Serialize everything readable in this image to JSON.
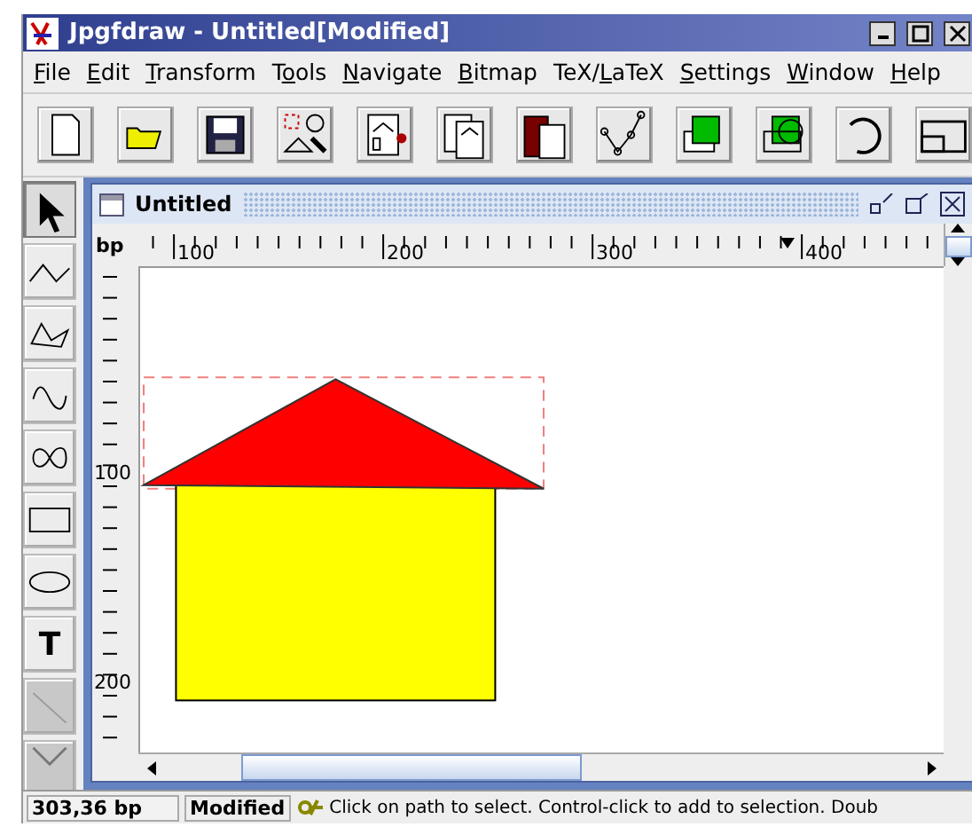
{
  "window": {
    "title": "Jpgfdraw - Untitled[Modified]"
  },
  "menu": [
    {
      "underlined": "F",
      "after": "ile"
    },
    {
      "underlined": "E",
      "after": "dit"
    },
    {
      "underlined": "T",
      "after": "ransform"
    },
    {
      "before": "T",
      "underlined": "o",
      "after": "ols"
    },
    {
      "underlined": "N",
      "after": "avigate"
    },
    {
      "underlined": "B",
      "after": "itmap"
    },
    {
      "before": "TeX/",
      "underlined": "L",
      "after": "aTeX"
    },
    {
      "underlined": "S",
      "after": "ettings"
    },
    {
      "underlined": "W",
      "after": "indow"
    },
    {
      "underlined": "H",
      "after": "elp"
    }
  ],
  "toolbar": [
    {
      "kind": "new"
    },
    {
      "kind": "open"
    },
    {
      "kind": "save"
    },
    {
      "kind": "select-all"
    },
    {
      "kind": "cut"
    },
    {
      "kind": "copy"
    },
    {
      "kind": "paste"
    },
    {
      "kind": "edit-path"
    },
    {
      "kind": "front"
    },
    {
      "kind": "back"
    },
    {
      "kind": "rotate"
    },
    {
      "kind": "reduce"
    }
  ],
  "tools": [
    {
      "kind": "select",
      "selected": true,
      "disabled": false
    },
    {
      "kind": "polyline",
      "selected": false,
      "disabled": false
    },
    {
      "kind": "closed",
      "selected": false,
      "disabled": false
    },
    {
      "kind": "curve",
      "selected": false,
      "disabled": false
    },
    {
      "kind": "loop",
      "selected": false,
      "disabled": false
    },
    {
      "kind": "rectangle",
      "selected": false,
      "disabled": false
    },
    {
      "kind": "ellipse",
      "selected": false,
      "disabled": false
    },
    {
      "kind": "text",
      "label": "T",
      "selected": false,
      "disabled": false
    },
    {
      "kind": "line",
      "selected": false,
      "disabled": true
    },
    {
      "kind": "chevron",
      "selected": false,
      "disabled": true
    }
  ],
  "document": {
    "title": "Untitled",
    "unit": "bp",
    "top_ruler": [
      "100",
      "200",
      "300",
      "400"
    ],
    "left_ruler": [
      "100",
      "200"
    ]
  },
  "status_bar": {
    "position": "303,36 bp",
    "state": "Modified",
    "message": "Click on path to select. Control-click to add to selection. Doub"
  }
}
